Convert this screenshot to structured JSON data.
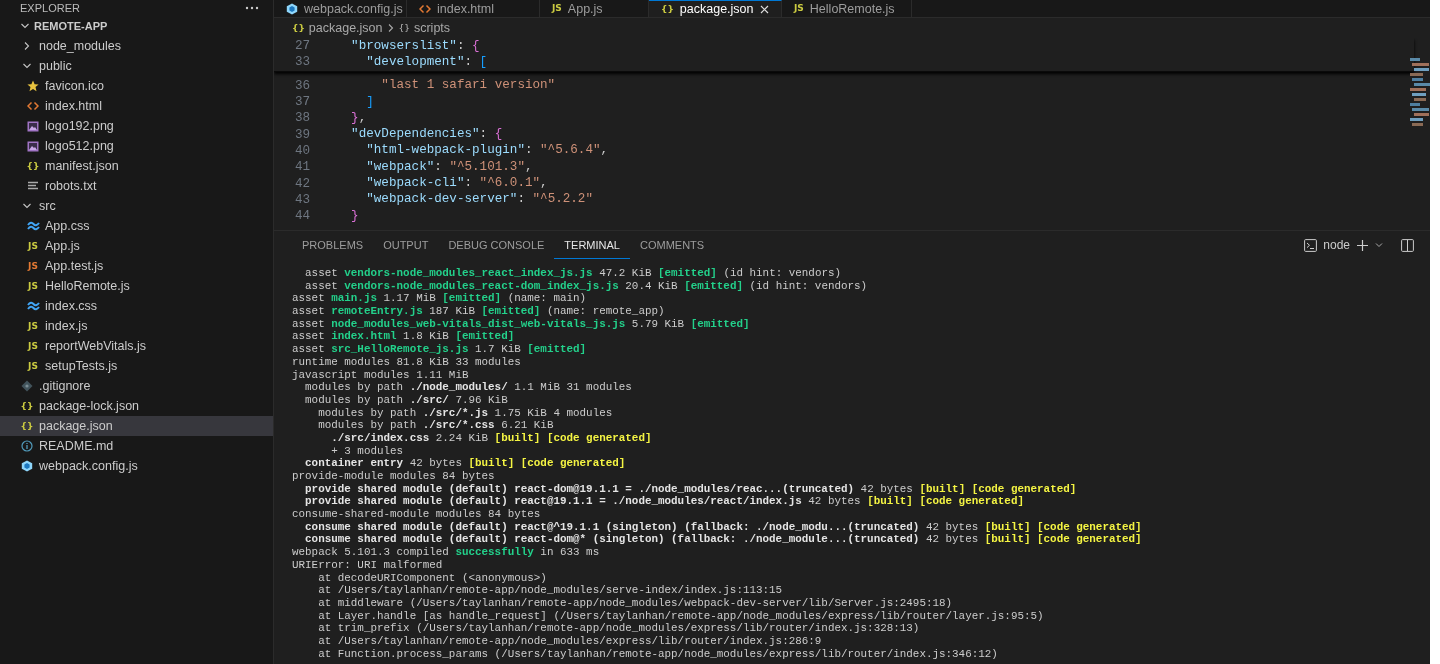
{
  "sidebar": {
    "title": "EXPLORER",
    "root": {
      "label": "REMOTE-APP",
      "expanded": true
    },
    "tree": [
      {
        "name": "node_modules",
        "kind": "folder",
        "expanded": false,
        "selected": false
      },
      {
        "name": "public",
        "kind": "folder",
        "expanded": true,
        "selected": false,
        "children": [
          {
            "name": "favicon.ico",
            "kind": "star",
            "selected": false
          },
          {
            "name": "index.html",
            "kind": "html",
            "selected": false
          },
          {
            "name": "logo192.png",
            "kind": "image",
            "selected": false
          },
          {
            "name": "logo512.png",
            "kind": "image",
            "selected": false
          },
          {
            "name": "manifest.json",
            "kind": "json",
            "glyph": "{}",
            "selected": false
          },
          {
            "name": "robots.txt",
            "kind": "text",
            "selected": false
          }
        ]
      },
      {
        "name": "src",
        "kind": "folder",
        "expanded": true,
        "selected": false,
        "children": [
          {
            "name": "App.css",
            "kind": "css",
            "selected": false
          },
          {
            "name": "App.js",
            "kind": "js",
            "glyph": "JS",
            "selected": false
          },
          {
            "name": "App.test.js",
            "kind": "jstest",
            "glyph": "JS",
            "selected": false
          },
          {
            "name": "HelloRemote.js",
            "kind": "js",
            "glyph": "JS",
            "selected": false
          },
          {
            "name": "index.css",
            "kind": "css",
            "selected": false
          },
          {
            "name": "index.js",
            "kind": "js",
            "glyph": "JS",
            "selected": false
          },
          {
            "name": "reportWebVitals.js",
            "kind": "js",
            "glyph": "JS",
            "selected": false
          },
          {
            "name": "setupTests.js",
            "kind": "js",
            "glyph": "JS",
            "selected": false
          }
        ]
      },
      {
        "name": ".gitignore",
        "kind": "git",
        "selected": false
      },
      {
        "name": "package-lock.json",
        "kind": "json",
        "glyph": "{}",
        "selected": false
      },
      {
        "name": "package.json",
        "kind": "json",
        "glyph": "{}",
        "selected": true
      },
      {
        "name": "README.md",
        "kind": "info",
        "selected": false
      },
      {
        "name": "webpack.config.js",
        "kind": "webpack",
        "selected": false
      }
    ]
  },
  "tabs": [
    {
      "label": "webpack.config.js",
      "kind": "webpack",
      "selected": false
    },
    {
      "label": "index.html",
      "kind": "html",
      "selected": false
    },
    {
      "label": "App.js",
      "kind": "js",
      "glyph": "JS",
      "selected": false
    },
    {
      "label": "package.json",
      "kind": "json",
      "glyph": "{}",
      "selected": true
    },
    {
      "label": "HelloRemote.js",
      "kind": "js",
      "glyph": "JS",
      "selected": false
    }
  ],
  "breadcrumb": [
    {
      "glyph": "{}",
      "label": "package.json"
    },
    {
      "glyph": "{}",
      "label": "scripts"
    }
  ],
  "sticky_lines": [
    {
      "n": "27",
      "tokens": [
        {
          "text": "  \"browserslist\"",
          "kind": "key"
        },
        {
          "text": ": ",
          "kind": "punct"
        },
        {
          "text": "{",
          "kind": "brace"
        }
      ]
    },
    {
      "n": "33",
      "tokens": [
        {
          "text": "    \"development\"",
          "kind": "key"
        },
        {
          "text": ": ",
          "kind": "punct"
        },
        {
          "text": "[",
          "kind": "bracket"
        }
      ]
    }
  ],
  "code_lines": [
    {
      "n": "36",
      "tokens": [
        {
          "text": "      \"last 1 safari version\"",
          "kind": "string"
        }
      ]
    },
    {
      "n": "37",
      "tokens": [
        {
          "text": "    ]",
          "kind": "bracket"
        }
      ]
    },
    {
      "n": "38",
      "tokens": [
        {
          "text": "  }",
          "kind": "brace"
        },
        {
          "text": ",",
          "kind": "punct"
        }
      ]
    },
    {
      "n": "39",
      "tokens": [
        {
          "text": "  \"devDependencies\"",
          "kind": "key"
        },
        {
          "text": ": ",
          "kind": "punct"
        },
        {
          "text": "{",
          "kind": "brace"
        }
      ]
    },
    {
      "n": "40",
      "tokens": [
        {
          "text": "    \"html-webpack-plugin\"",
          "kind": "key"
        },
        {
          "text": ": ",
          "kind": "punct"
        },
        {
          "text": "\"^5.6.4\"",
          "kind": "string"
        },
        {
          "text": ",",
          "kind": "punct"
        }
      ]
    },
    {
      "n": "41",
      "tokens": [
        {
          "text": "    \"webpack\"",
          "kind": "key"
        },
        {
          "text": ": ",
          "kind": "punct"
        },
        {
          "text": "\"^5.101.3\"",
          "kind": "string"
        },
        {
          "text": ",",
          "kind": "punct"
        }
      ]
    },
    {
      "n": "42",
      "tokens": [
        {
          "text": "    \"webpack-cli\"",
          "kind": "key"
        },
        {
          "text": ": ",
          "kind": "punct"
        },
        {
          "text": "\"^6.0.1\"",
          "kind": "string"
        },
        {
          "text": ",",
          "kind": "punct"
        }
      ]
    },
    {
      "n": "43",
      "tokens": [
        {
          "text": "    \"webpack-dev-server\"",
          "kind": "key"
        },
        {
          "text": ": ",
          "kind": "punct"
        },
        {
          "text": "\"^5.2.2\"",
          "kind": "string"
        }
      ]
    },
    {
      "n": "44",
      "tokens": [
        {
          "text": "  }",
          "kind": "brace"
        }
      ]
    }
  ],
  "panel": {
    "tabs": [
      {
        "label": "PROBLEMS",
        "selected": false
      },
      {
        "label": "OUTPUT",
        "selected": false
      },
      {
        "label": "DEBUG CONSOLE",
        "selected": false
      },
      {
        "label": "TERMINAL",
        "selected": true
      },
      {
        "label": "COMMENTS",
        "selected": false
      }
    ],
    "terminal_name": "node",
    "terminal_lines": [
      [
        {
          "text": "  asset ",
          "kind": "plain"
        },
        {
          "text": "vendors-node_modules_react_index_js.js",
          "kind": "green"
        },
        {
          "text": " 47.2 KiB ",
          "kind": "plain"
        },
        {
          "text": "[emitted]",
          "kind": "green"
        },
        {
          "text": " (id hint: vendors)",
          "kind": "plain"
        }
      ],
      [
        {
          "text": "  asset ",
          "kind": "plain"
        },
        {
          "text": "vendors-node_modules_react-dom_index_js.js",
          "kind": "green"
        },
        {
          "text": " 20.4 KiB ",
          "kind": "plain"
        },
        {
          "text": "[emitted]",
          "kind": "green"
        },
        {
          "text": " (id hint: vendors)",
          "kind": "plain"
        }
      ],
      [
        {
          "text": "asset ",
          "kind": "plain"
        },
        {
          "text": "main.js",
          "kind": "green"
        },
        {
          "text": " 1.17 MiB ",
          "kind": "plain"
        },
        {
          "text": "[emitted]",
          "kind": "green"
        },
        {
          "text": " (name: main)",
          "kind": "plain"
        }
      ],
      [
        {
          "text": "asset ",
          "kind": "plain"
        },
        {
          "text": "remoteEntry.js",
          "kind": "green"
        },
        {
          "text": " 187 KiB ",
          "kind": "plain"
        },
        {
          "text": "[emitted]",
          "kind": "green"
        },
        {
          "text": " (name: remote_app)",
          "kind": "plain"
        }
      ],
      [
        {
          "text": "asset ",
          "kind": "plain"
        },
        {
          "text": "node_modules_web-vitals_dist_web-vitals_js.js",
          "kind": "green"
        },
        {
          "text": " 5.79 KiB ",
          "kind": "plain"
        },
        {
          "text": "[emitted]",
          "kind": "green"
        }
      ],
      [
        {
          "text": "asset ",
          "kind": "plain"
        },
        {
          "text": "index.html",
          "kind": "green"
        },
        {
          "text": " 1.8 KiB ",
          "kind": "plain"
        },
        {
          "text": "[emitted]",
          "kind": "green"
        }
      ],
      [
        {
          "text": "asset ",
          "kind": "plain"
        },
        {
          "text": "src_HelloRemote_js.js",
          "kind": "green"
        },
        {
          "text": " 1.7 KiB ",
          "kind": "plain"
        },
        {
          "text": "[emitted]",
          "kind": "green"
        }
      ],
      [
        {
          "text": "runtime modules 81.8 KiB 33 modules",
          "kind": "plain"
        }
      ],
      [
        {
          "text": "javascript modules 1.11 MiB",
          "kind": "plain"
        }
      ],
      [
        {
          "text": "  modules by path ",
          "kind": "plain"
        },
        {
          "text": "./node_modules/",
          "kind": "bold"
        },
        {
          "text": " 1.1 MiB 31 modules",
          "kind": "plain"
        }
      ],
      [
        {
          "text": "  modules by path ",
          "kind": "plain"
        },
        {
          "text": "./src/",
          "kind": "bold"
        },
        {
          "text": " 7.96 KiB",
          "kind": "plain"
        }
      ],
      [
        {
          "text": "    modules by path ",
          "kind": "plain"
        },
        {
          "text": "./src/*.js",
          "kind": "bold"
        },
        {
          "text": " 1.75 KiB 4 modules",
          "kind": "plain"
        }
      ],
      [
        {
          "text": "    modules by path ",
          "kind": "plain"
        },
        {
          "text": "./src/*.css",
          "kind": "bold"
        },
        {
          "text": " 6.21 KiB",
          "kind": "plain"
        }
      ],
      [
        {
          "text": "      ./src/index.css",
          "kind": "bold"
        },
        {
          "text": " 2.24 KiB ",
          "kind": "plain"
        },
        {
          "text": "[built] [code generated]",
          "kind": "yellow"
        }
      ],
      [
        {
          "text": "      + 3 modules",
          "kind": "plain"
        }
      ],
      [
        {
          "text": "  container entry",
          "kind": "bold"
        },
        {
          "text": " 42 bytes ",
          "kind": "plain"
        },
        {
          "text": "[built] [code generated]",
          "kind": "yellow"
        }
      ],
      [
        {
          "text": "provide-module modules 84 bytes",
          "kind": "plain"
        }
      ],
      [
        {
          "text": "  provide shared module (default) react-dom@19.1.1 = ./node_modules/reac...(truncated)",
          "kind": "bold"
        },
        {
          "text": " 42 bytes ",
          "kind": "plain"
        },
        {
          "text": "[built] [code generated]",
          "kind": "yellow"
        }
      ],
      [
        {
          "text": "  provide shared module (default) react@19.1.1 = ./node_modules/react/index.js",
          "kind": "bold"
        },
        {
          "text": " 42 bytes ",
          "kind": "plain"
        },
        {
          "text": "[built] [code generated]",
          "kind": "yellow"
        }
      ],
      [
        {
          "text": "consume-shared-module modules 84 bytes",
          "kind": "plain"
        }
      ],
      [
        {
          "text": "  consume shared module (default) react@^19.1.1 (singleton) (fallback: ./node_modu...(truncated)",
          "kind": "bold"
        },
        {
          "text": " 42 bytes ",
          "kind": "plain"
        },
        {
          "text": "[built] [code generated]",
          "kind": "yellow"
        }
      ],
      [
        {
          "text": "  consume shared module (default) react-dom@* (singleton) (fallback: ./node_module...(truncated)",
          "kind": "bold"
        },
        {
          "text": " 42 bytes ",
          "kind": "plain"
        },
        {
          "text": "[built] [code generated]",
          "kind": "yellow"
        }
      ],
      [
        {
          "text": "webpack 5.101.3 compiled ",
          "kind": "plain"
        },
        {
          "text": "successfully",
          "kind": "green"
        },
        {
          "text": " in 633 ms",
          "kind": "plain"
        }
      ],
      [
        {
          "text": "URIError: URI malformed",
          "kind": "plain"
        }
      ],
      [
        {
          "text": "    at decodeURIComponent (<anonymous>)",
          "kind": "plain"
        }
      ],
      [
        {
          "text": "    at /Users/taylanhan/remote-app/node_modules/serve-index/index.js:113:15",
          "kind": "plain"
        }
      ],
      [
        {
          "text": "    at middleware (/Users/taylanhan/remote-app/node_modules/webpack-dev-server/lib/Server.js:2495:18)",
          "kind": "plain"
        }
      ],
      [
        {
          "text": "    at Layer.handle [as handle_request] (/Users/taylanhan/remote-app/node_modules/express/lib/router/layer.js:95:5)",
          "kind": "plain"
        }
      ],
      [
        {
          "text": "    at trim_prefix (/Users/taylanhan/remote-app/node_modules/express/lib/router/index.js:328:13)",
          "kind": "plain"
        }
      ],
      [
        {
          "text": "    at /Users/taylanhan/remote-app/node_modules/express/lib/router/index.js:286:9",
          "kind": "plain"
        }
      ],
      [
        {
          "text": "    at Function.process_params (/Users/taylanhan/remote-app/node_modules/express/lib/router/index.js:346:12)",
          "kind": "plain"
        }
      ]
    ]
  }
}
